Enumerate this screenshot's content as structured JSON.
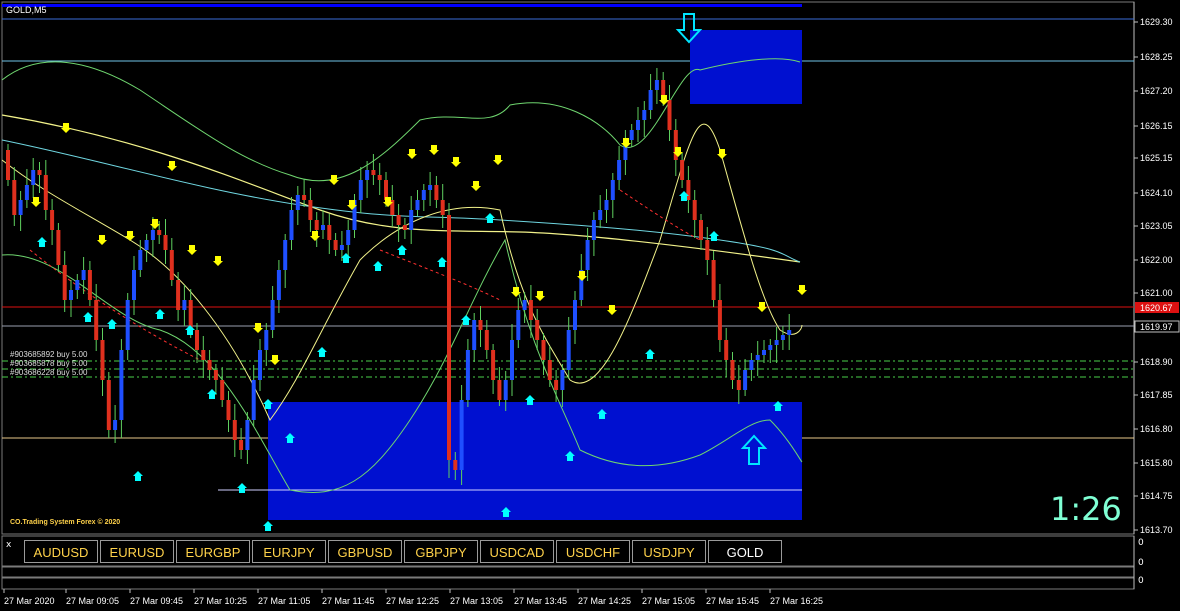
{
  "window": {
    "title": "GOLD,M5"
  },
  "clock": "1:26",
  "watermark": "CO.Trading System Forex © 2020",
  "orders": [
    "#903685892 buy 5.00",
    "#903685878 buy 5.00",
    "#903686228 buy 5.00"
  ],
  "price_axis": {
    "labels": [
      "1629.30",
      "1628.25",
      "1627.20",
      "1626.15",
      "1625.15",
      "1624.10",
      "1623.05",
      "1622.00",
      "1621.00",
      "1618.90",
      "1617.85",
      "1616.80",
      "1615.80",
      "1614.75",
      "1613.70"
    ],
    "current_price": "1619.97",
    "marked_price": "1620.67"
  },
  "time_axis": {
    "labels": [
      "27 Mar 2020",
      "27 Mar 09:05",
      "27 Mar 09:45",
      "27 Mar 10:25",
      "27 Mar 11:05",
      "27 Mar 11:45",
      "27 Mar 12:25",
      "27 Mar 13:05",
      "27 Mar 13:45",
      "27 Mar 14:25",
      "27 Mar 15:05",
      "27 Mar 15:45",
      "27 Mar 16:25"
    ]
  },
  "symbols": [
    {
      "label": "AUDUSD",
      "active": false
    },
    {
      "label": "EURUSD",
      "active": false
    },
    {
      "label": "EURGBP",
      "active": false
    },
    {
      "label": "EURJPY",
      "active": false
    },
    {
      "label": "GBPUSD",
      "active": false
    },
    {
      "label": "GBPJPY",
      "active": false
    },
    {
      "label": "USDCAD",
      "active": false
    },
    {
      "label": "USDCHF",
      "active": false
    },
    {
      "label": "USDJPY",
      "active": false
    },
    {
      "label": "GOLD",
      "active": true
    }
  ],
  "indicator_panel": {
    "close_label": "x",
    "scale_labels": [
      "0",
      "0",
      "0"
    ]
  },
  "colors": {
    "bull": "#1f4fff",
    "bear": "#e0301e",
    "zone": "#0010d0",
    "arrow_up": "#00ffff",
    "arrow_down": "#ffff00",
    "line_yellow": "#f2f28a",
    "line_green": "#6fd66f",
    "line_cyan": "#6fd6e0"
  }
}
